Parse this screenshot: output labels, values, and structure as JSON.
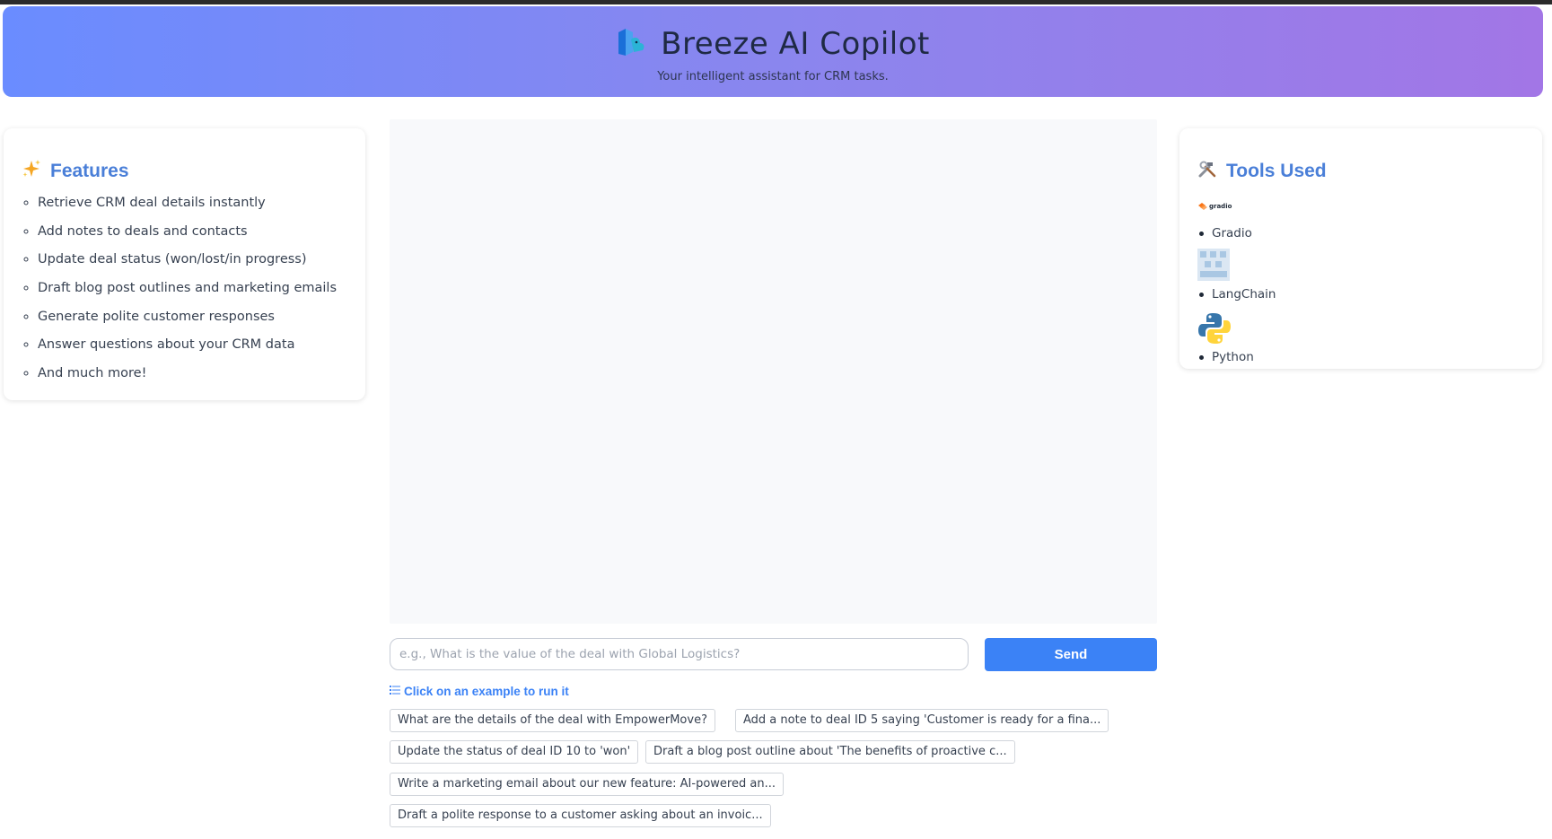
{
  "header": {
    "title": "Breeze AI Copilot",
    "subtitle": "Your intelligent assistant for CRM tasks."
  },
  "features": {
    "heading": "Features",
    "icon": "sparkles-icon",
    "items": [
      "Retrieve CRM deal details instantly",
      "Add notes to deals and contacts",
      "Update deal status (won/lost/in progress)",
      "Draft blog post outlines and marketing emails",
      "Generate polite customer responses",
      "Answer questions about your CRM data",
      "And much more!"
    ]
  },
  "tools": {
    "heading": "Tools Used",
    "icon": "hammer-wrench-icon",
    "items": [
      {
        "name": "Gradio",
        "logo": "gradio-logo",
        "logo_text": "gradio"
      },
      {
        "name": "LangChain",
        "logo": "langchain-logo"
      },
      {
        "name": "Python",
        "logo": "python-logo"
      }
    ]
  },
  "input": {
    "placeholder": "e.g., What is the value of the deal with Global Logistics?",
    "value": ""
  },
  "send_label": "Send",
  "examples": {
    "label": "Click on an example to run it",
    "items": [
      "What are the details of the deal with EmpowerMove?",
      "Add a note to deal ID 5 saying 'Customer is ready for a fina...",
      "Update the status of deal ID 10 to 'won'",
      "Draft a blog post outline about 'The benefits of proactive c...",
      "Write a marketing email about our new feature: AI-powered an...",
      "Draft a polite response to a customer asking about an invoic..."
    ]
  },
  "colors": {
    "accent": "#3b82f6",
    "heading": "#4a7fd8",
    "header_gradient_start": "#6a8cff",
    "header_gradient_end": "#a276e6"
  }
}
